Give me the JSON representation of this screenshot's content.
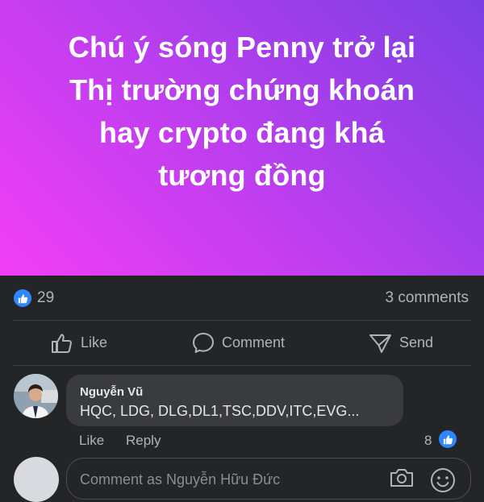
{
  "post": {
    "text_lines": [
      "Chú ý sóng Penny trở lại",
      "Thị trường chứng khoán",
      "hay crypto đang khá",
      "tương đồng"
    ]
  },
  "stats": {
    "like_count": "29",
    "comments_label": "3 comments"
  },
  "actions": {
    "like": "Like",
    "comment": "Comment",
    "send": "Send"
  },
  "comment": {
    "author": "Nguyễn Vũ",
    "text": "HQC, LDG, DLG,DL1,TSC,DDV,ITC,EVG...",
    "like_label": "Like",
    "reply_label": "Reply",
    "reaction_count": "8"
  },
  "composer": {
    "placeholder": "Comment as Nguyễn Hữu Đức"
  },
  "colors": {
    "accent": "#2d88ff",
    "background": "#242526",
    "bubble": "#3a3b3c",
    "gradient_start": "#f23ef6",
    "gradient_end": "#7b3fe4"
  },
  "icons": [
    "like-badge-icon",
    "thumb-up-icon",
    "comment-icon",
    "send-icon",
    "camera-icon",
    "emoji-icon"
  ]
}
